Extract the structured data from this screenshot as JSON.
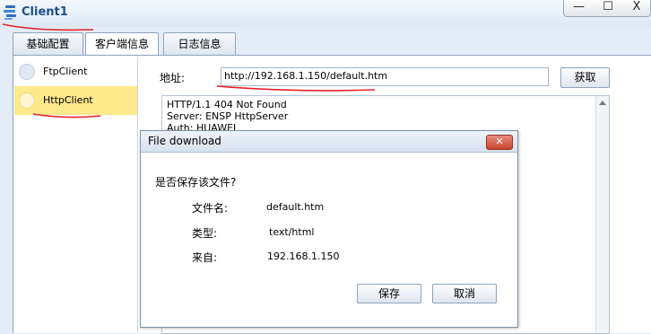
{
  "window": {
    "title": "Client1",
    "minimize_glyph": "—",
    "maximize_glyph": "☐",
    "close_glyph": "X"
  },
  "tabs": [
    {
      "label": "基础配置",
      "active": false
    },
    {
      "label": "客户端信息",
      "active": true
    },
    {
      "label": "日志信息",
      "active": false
    }
  ],
  "sidebar": {
    "items": [
      {
        "label": "FtpClient",
        "selected": false
      },
      {
        "label": "HttpClient",
        "selected": true
      }
    ]
  },
  "address": {
    "label": "地址:",
    "value": "http://192.168.1.150/default.htm",
    "fetch_label": "获取"
  },
  "response": {
    "lines": [
      "HTTP/1.1 404 Not Found",
      "Server: ENSP HttpServer",
      "Auth: HUAWEI"
    ]
  },
  "dialog": {
    "title": "File download",
    "close_glyph": "✕",
    "question": "是否保存该文件?",
    "fields": [
      {
        "key": "文件名:",
        "value": "default.htm"
      },
      {
        "key": "类型:",
        "value": "text/html"
      },
      {
        "key": "来自:",
        "value": "192.168.1.150"
      }
    ],
    "save_label": "保存",
    "cancel_label": "取消"
  },
  "colors": {
    "title_text": "#1c4f8d",
    "selected_item": "#fde88c",
    "annotation_red": "#e8202a",
    "dialog_close": "#c9452f"
  }
}
